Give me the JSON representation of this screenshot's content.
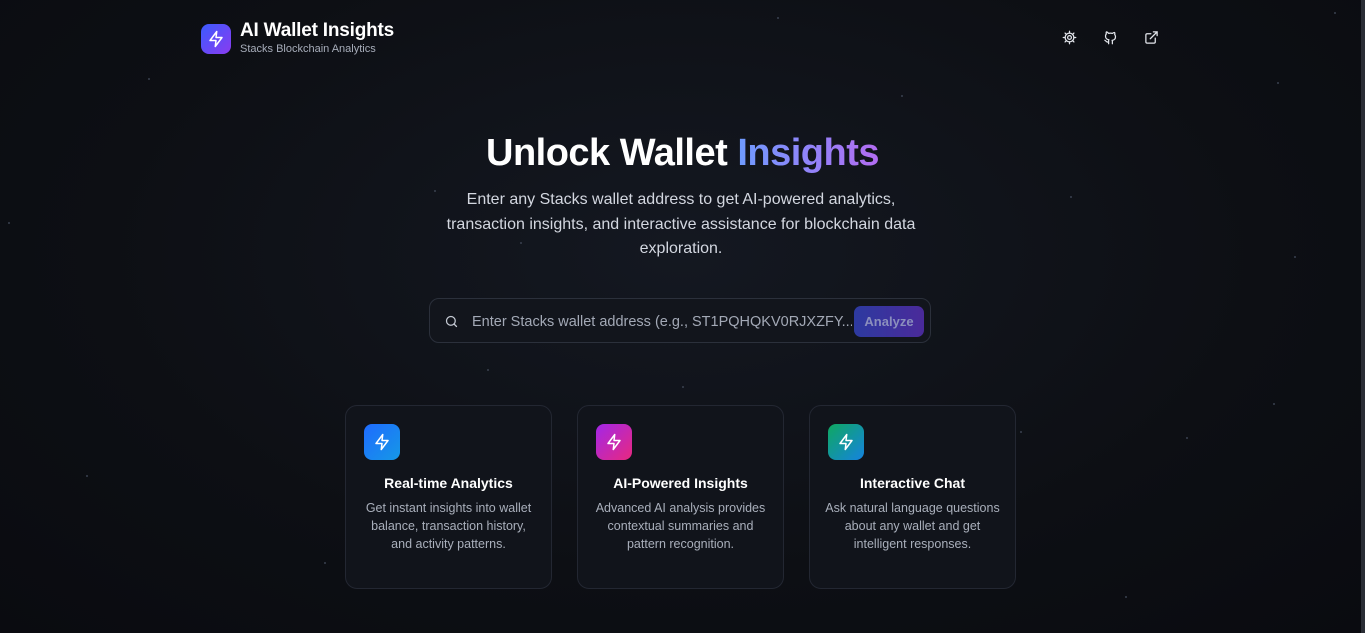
{
  "header": {
    "title": "AI Wallet Insights",
    "subtitle": "Stacks Blockchain Analytics",
    "logo_icon": "lightning-icon",
    "actions": [
      {
        "icon": "settings-icon"
      },
      {
        "icon": "github-icon"
      },
      {
        "icon": "external-link-icon"
      }
    ]
  },
  "hero": {
    "title_main": "Unlock Wallet",
    "title_accent": "Insights",
    "description": "Enter any Stacks wallet address to get AI-powered analytics, transaction insights, and interactive assistance for blockchain data exploration."
  },
  "search": {
    "placeholder": "Enter Stacks wallet address (e.g., ST1PQHQKV0RJXZFY...)",
    "value": "",
    "button_label": "Analyze"
  },
  "features": [
    {
      "title": "Real-time Analytics",
      "description": "Get instant insights into wallet balance, transaction history, and activity patterns.",
      "icon": "lightning-icon",
      "gradient": [
        "#1f6bff",
        "#1598e6"
      ]
    },
    {
      "title": "AI-Powered Insights",
      "description": "Advanced AI analysis provides contextual summaries and pattern recognition.",
      "icon": "lightning-icon",
      "gradient": [
        "#a227e8",
        "#e8287f"
      ]
    },
    {
      "title": "Interactive Chat",
      "description": "Ask natural language questions about any wallet and get intelligent responses.",
      "icon": "lightning-icon",
      "gradient": [
        "#0fa860",
        "#1583e0"
      ]
    }
  ],
  "colors": {
    "background": "#0d0f14",
    "accent_start": "#6e9bff",
    "accent_end": "#b36cf2"
  }
}
